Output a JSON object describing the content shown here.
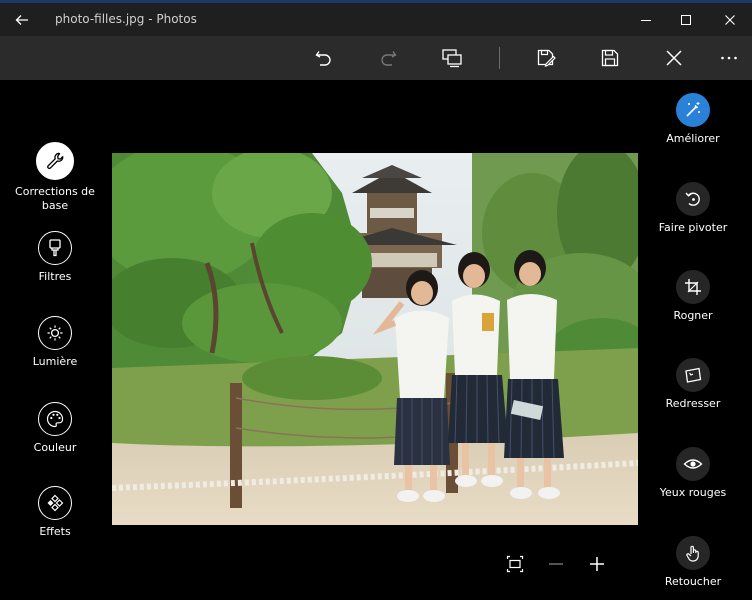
{
  "window": {
    "title": "photo-filles.jpg - Photos"
  },
  "left_panel": {
    "items": [
      {
        "label": "Corrections de base",
        "icon": "wrench-icon"
      },
      {
        "label": "Filtres",
        "icon": "brush-icon"
      },
      {
        "label": "Lumière",
        "icon": "sun-icon"
      },
      {
        "label": "Couleur",
        "icon": "palette-icon"
      },
      {
        "label": "Effets",
        "icon": "effects-icon"
      }
    ]
  },
  "right_panel": {
    "items": [
      {
        "label": "Améliorer",
        "icon": "magic-wand-icon"
      },
      {
        "label": "Faire pivoter",
        "icon": "rotate-icon"
      },
      {
        "label": "Rogner",
        "icon": "crop-icon"
      },
      {
        "label": "Redresser",
        "icon": "straighten-icon"
      },
      {
        "label": "Yeux rouges",
        "icon": "eye-icon"
      },
      {
        "label": "Retoucher",
        "icon": "touch-hand-icon"
      }
    ]
  },
  "colors": {
    "accent": "#2a82d8",
    "titlebar": "#1f1f1f",
    "toolbar": "#2b2b2b",
    "background": "#000000"
  }
}
